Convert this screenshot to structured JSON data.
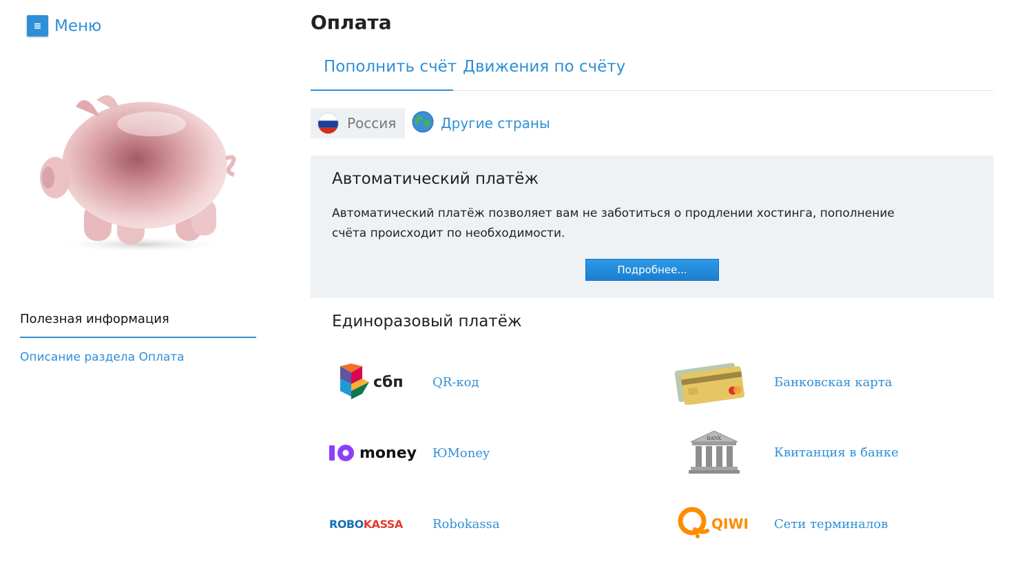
{
  "menu": {
    "label": "Меню",
    "icon_glyph": "≡"
  },
  "sidebar": {
    "info_title": "Полезная информация",
    "links": [
      {
        "label": "Описание раздела Оплата"
      }
    ]
  },
  "page": {
    "title": "Оплата"
  },
  "tabs": [
    {
      "label": "Пополнить счёт",
      "active": true
    },
    {
      "label": "Движения по счёту",
      "active": false
    }
  ],
  "countries": {
    "russia": "Россия",
    "other": "Другие страны"
  },
  "auto_payment": {
    "title": "Автоматический платёж",
    "description": "Автоматический платёж позволяет вам не заботиться о продлении хостинга, пополнение счёта происходит по необходимости.",
    "button": "Подробнее..."
  },
  "one_time": {
    "title": "Единоразовый платёж",
    "methods": [
      {
        "logo": "sbp-logo",
        "logo_text": "сбп",
        "label": "QR-код"
      },
      {
        "logo": "bank-card-logo",
        "label": "Банковская карта"
      },
      {
        "logo": "yoomoney-logo",
        "logo_text": "money",
        "label": "ЮMoney"
      },
      {
        "logo": "bank-building-logo",
        "logo_text": "BANK",
        "label": "Квитанция в банке"
      },
      {
        "logo": "robokassa-logo",
        "logo_text_a": "ROBO",
        "logo_text_b": "KASSA",
        "label": "Robokassa"
      },
      {
        "logo": "qiwi-logo",
        "logo_text": "QIWI",
        "label": "Сети терминалов"
      }
    ]
  },
  "colors": {
    "accent": "#2e8fd6",
    "panel": "#eef2f5"
  }
}
